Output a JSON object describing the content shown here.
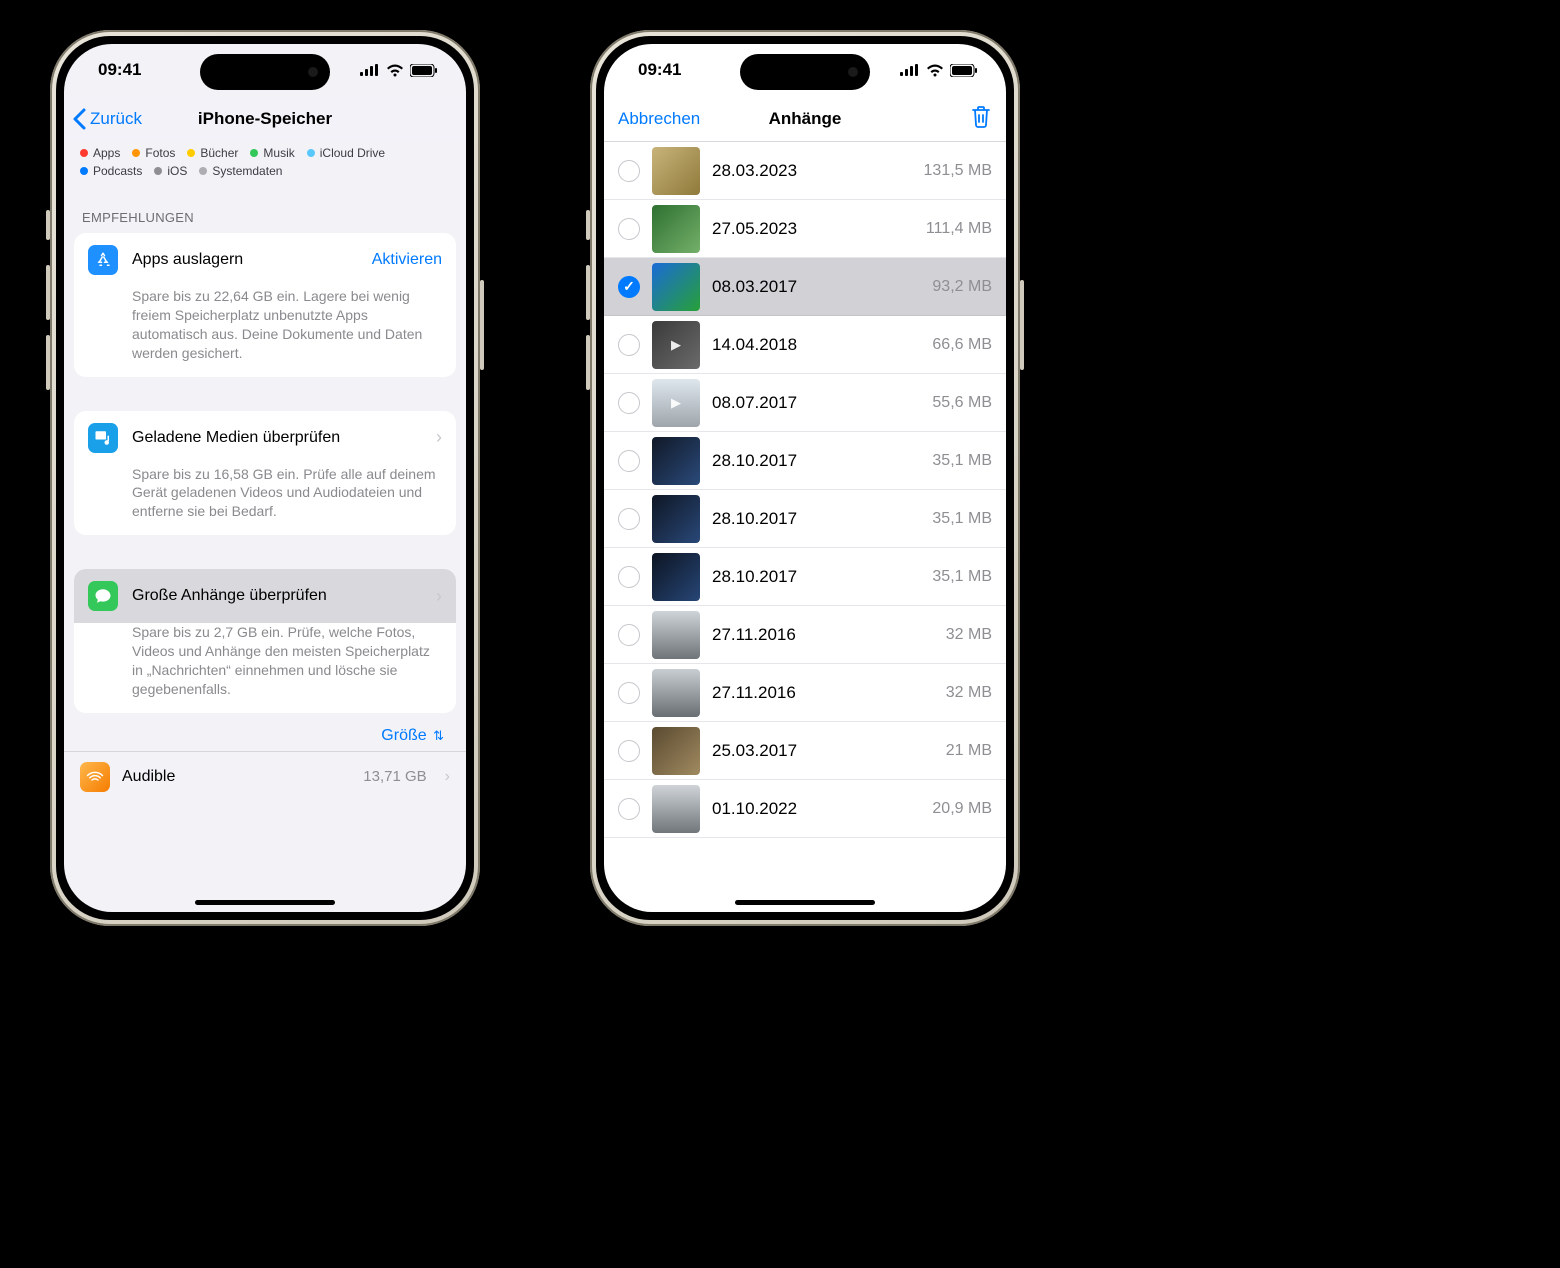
{
  "status": {
    "time": "09:41"
  },
  "left": {
    "nav": {
      "back": "Zurück",
      "title": "iPhone-Speicher"
    },
    "legend": [
      {
        "color": "#ff3b30",
        "label": "Apps"
      },
      {
        "color": "#ff9500",
        "label": "Fotos"
      },
      {
        "color": "#ffcc00",
        "label": "Bücher"
      },
      {
        "color": "#34c759",
        "label": "Musik"
      },
      {
        "color": "#5ac8fa",
        "label": "iCloud Drive"
      },
      {
        "color": "#007aff",
        "label": "Podcasts"
      },
      {
        "color": "#8e8e93",
        "label": "iOS"
      },
      {
        "color": "#aeaeb2",
        "label": "Systemdaten"
      }
    ],
    "recommendations_header": "Empfehlungen",
    "rec1": {
      "title": "Apps auslagern",
      "action": "Aktivieren",
      "desc": "Spare bis zu 22,64 GB ein. Lagere bei wenig freiem Speicherplatz unbenutzte Apps automatisch aus. Deine Dokumente und Daten werden gesichert."
    },
    "rec2": {
      "title": "Geladene Medien überprüfen",
      "desc": "Spare bis zu 16,58 GB ein. Prüfe alle auf deinem Gerät geladenen Videos und Audio­dateien und entferne sie bei Bedarf."
    },
    "rec3": {
      "title": "Große Anhänge überprüfen",
      "desc": "Spare bis zu 2,7 GB ein. Prüfe, welche Fotos, Videos und Anhänge den meisten Speicherplatz in „Nachrichten“ einnehmen und lösche sie gegebenenfalls."
    },
    "sort_label": "Größe",
    "app": {
      "name": "Audible",
      "size": "13,71 GB"
    }
  },
  "right": {
    "nav": {
      "cancel": "Abbrechen",
      "title": "Anhänge"
    },
    "rows": [
      {
        "date": "28.03.2023",
        "size": "131,5 MB",
        "thumb": "linear-gradient(135deg,#c8b37a,#8f7a3a)",
        "play": false,
        "selected": false
      },
      {
        "date": "27.05.2023",
        "size": "111,4 MB",
        "thumb": "linear-gradient(135deg,#2e7031,#74b06a)",
        "play": false,
        "selected": false
      },
      {
        "date": "08.03.2017",
        "size": "93,2 MB",
        "thumb": "linear-gradient(135deg,#1a6bd6,#27a038)",
        "play": false,
        "selected": true
      },
      {
        "date": "14.04.2018",
        "size": "66,6 MB",
        "thumb": "linear-gradient(135deg,#3a3a3a,#6b6b6b)",
        "play": true,
        "selected": false
      },
      {
        "date": "08.07.2017",
        "size": "55,6 MB",
        "thumb": "linear-gradient(180deg,#dfe7ee,#9ea6ac)",
        "play": true,
        "selected": false
      },
      {
        "date": "28.10.2017",
        "size": "35,1 MB",
        "thumb": "linear-gradient(135deg,#101826,#2a4a7a)",
        "play": false,
        "selected": false
      },
      {
        "date": "28.10.2017",
        "size": "35,1 MB",
        "thumb": "linear-gradient(135deg,#0e1624,#294878)",
        "play": false,
        "selected": false
      },
      {
        "date": "28.10.2017",
        "size": "35,1 MB",
        "thumb": "linear-gradient(135deg,#0c1422,#274676)",
        "play": false,
        "selected": false
      },
      {
        "date": "27.11.2016",
        "size": "32 MB",
        "thumb": "linear-gradient(180deg,#cfd4d8,#6f7478)",
        "play": false,
        "selected": false
      },
      {
        "date": "27.11.2016",
        "size": "32 MB",
        "thumb": "linear-gradient(180deg,#c9ced2,#696e72)",
        "play": false,
        "selected": false
      },
      {
        "date": "25.03.2017",
        "size": "21 MB",
        "thumb": "linear-gradient(135deg,#5a4a30,#a08a60)",
        "play": false,
        "selected": false
      },
      {
        "date": "01.10.2022",
        "size": "20,9 MB",
        "thumb": "linear-gradient(180deg,#d0d4d8,#70767a)",
        "play": false,
        "selected": false
      }
    ]
  }
}
